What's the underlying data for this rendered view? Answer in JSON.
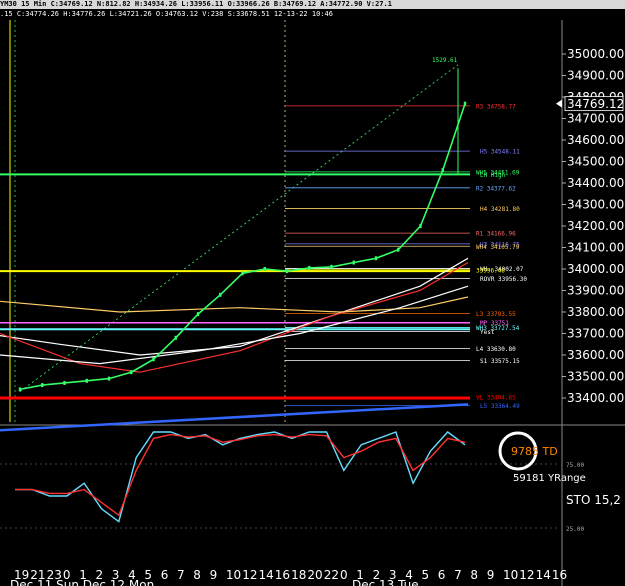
{
  "header": {
    "title_bar": "YM30 15 Min C:34769.12 N:812.82 H:34934.26 L:33956.11 O:33966.26 B:34769.12 A:34772.90 V:27.1",
    "info_line": ".15 C:34774.26 H:34776.26 L:34721.26 O:34763.12 V:238 S:33678.51 12-13-22 10:46"
  },
  "price_axis": {
    "ticks": [
      "35000.00",
      "34900.00",
      "34800.00",
      "34700.00",
      "34600.00",
      "34500.00",
      "34400.00",
      "34300.00",
      "34200.00",
      "34100.00",
      "34000.00",
      "33900.00",
      "33800.00",
      "33700.00",
      "33600.00",
      "33500.00",
      "33400.00"
    ],
    "current_price": "34769.12"
  },
  "time_axis": {
    "ticks": [
      "19",
      "21",
      "23",
      "0",
      "1",
      "2",
      "3",
      "4",
      "5",
      "6",
      "7",
      "8",
      "9",
      "10",
      "12",
      "14",
      "16",
      "18",
      "20",
      "22",
      "0",
      "1",
      "2",
      "3",
      "4",
      "5",
      "6",
      "7",
      "8",
      "9",
      "10",
      "12",
      "14",
      "16"
    ],
    "session_labels": [
      "Dec 11 Sun Dec 12 Mon",
      "Dec 13 Tue"
    ]
  },
  "chart_data": [
    {
      "type": "line",
      "title": "",
      "ylim": [
        33230,
        35090
      ],
      "levels": [
        {
          "label": "R3 34758.77",
          "value": 34758.77,
          "color": "#ff3030"
        },
        {
          "label": "H5 34548.11",
          "value": 34548.11,
          "color": "#8080ff"
        },
        {
          "label": "WH5 34451.69",
          "value": 34451.69,
          "color": "#33ff66"
        },
        {
          "label": "LH High",
          "value": 34440,
          "color": "#33ff66"
        },
        {
          "label": "R2 34377.62",
          "value": 34377.62,
          "color": "#66aaff"
        },
        {
          "label": "H4 34281.80",
          "value": 34281.8,
          "color": "#ffcc66"
        },
        {
          "label": "R1 34166.96",
          "value": 34166.96,
          "color": "#ff6666"
        },
        {
          "label": "H3 34116.75",
          "value": 34116.75,
          "color": "#8080ff"
        },
        {
          "label": "WH4 34105.79",
          "value": 34105.79,
          "color": "#ffcc66"
        },
        {
          "label": "WH- 34002.07",
          "value": 34002.07,
          "color": "#ffffff"
        },
        {
          "label": "33996.46",
          "value": 33996.46,
          "color": "#ffff00"
        },
        {
          "label": "ROVR 33956.30",
          "value": 33956.3,
          "color": "#ffffff"
        },
        {
          "label": "L3 33793.55",
          "value": 33793.55,
          "color": "#ff6600"
        },
        {
          "label": "MP 33751",
          "value": 33751,
          "color": "#ff66ff"
        },
        {
          "label": "WH3 33727.54",
          "value": 33727.54,
          "color": "#66ffff"
        },
        {
          "label": "Yest",
          "value": 33710,
          "color": "#ffffff"
        },
        {
          "label": "L4 33630.80",
          "value": 33630.8,
          "color": "#ffffff"
        },
        {
          "label": "S1 33575.15",
          "value": 33575.15,
          "color": "#ffffff"
        },
        {
          "label": "VL 33404.65",
          "value": 33404.65,
          "color": "#ff0000"
        },
        {
          "label": "L5 33364.49",
          "value": 33364.49,
          "color": "#3366ff"
        }
      ],
      "annotations": [
        {
          "label": "1529.61",
          "color": "#33ff66"
        }
      ],
      "price_series": {
        "x": [
          0,
          5,
          10,
          15,
          20,
          25,
          30,
          35,
          40,
          45,
          50,
          55,
          60,
          65,
          70,
          75,
          80,
          85,
          90,
          95,
          100
        ],
        "y": [
          33440,
          33460,
          33470,
          33480,
          33490,
          33520,
          33580,
          33680,
          33790,
          33880,
          33980,
          34000,
          33990,
          34005,
          34010,
          34030,
          34050,
          34090,
          34200,
          34460,
          34769
        ]
      }
    },
    {
      "type": "line",
      "title": "",
      "ylim": [
        0,
        100
      ],
      "y_ticks": [
        "25.00",
        "75.00"
      ],
      "labels": {
        "td": "9785 TD",
        "yrange": "59181 YRange",
        "sto": "STO  15,2"
      },
      "series": [
        {
          "values": [
            55,
            55,
            50,
            50,
            60,
            40,
            30,
            80,
            100,
            100,
            95,
            98,
            90,
            95,
            98,
            100,
            95,
            100,
            100,
            70,
            90,
            95,
            100,
            60,
            85,
            100,
            90
          ]
        },
        {
          "values": [
            55,
            55,
            52,
            52,
            55,
            45,
            35,
            70,
            95,
            98,
            96,
            97,
            92,
            94,
            97,
            98,
            96,
            98,
            97,
            80,
            85,
            92,
            95,
            70,
            80,
            95,
            92
          ]
        }
      ]
    }
  ],
  "colors": {
    "background": "#000000",
    "up": "#33ff66",
    "axis_text": "#ffffff",
    "grid": "#555555"
  }
}
